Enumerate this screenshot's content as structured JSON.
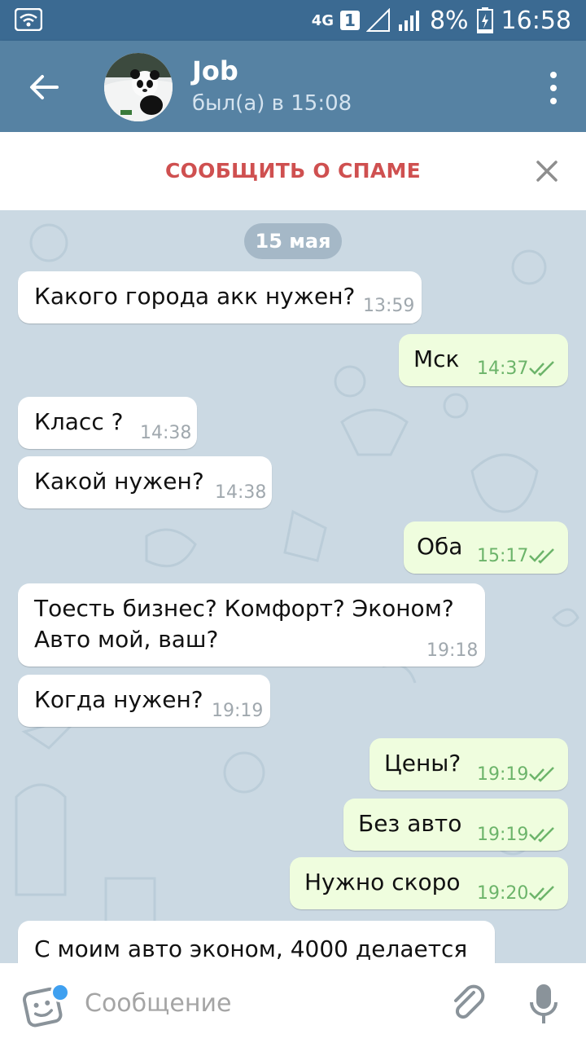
{
  "status": {
    "network": "4G",
    "sim": "1",
    "battery": "8%",
    "time": "16:58"
  },
  "header": {
    "title": "Job",
    "subtitle": "был(а) в 15:08"
  },
  "spam": {
    "label": "СООБЩИТЬ О СПАМЕ"
  },
  "chat": {
    "date": "15 мая",
    "messages": [
      {
        "dir": "in",
        "text": "Какого города акк нужен?",
        "time": "13:59"
      },
      {
        "dir": "out",
        "text": "Мск",
        "time": "14:37"
      },
      {
        "dir": "in",
        "text": "Класс ?",
        "time": "14:38"
      },
      {
        "dir": "in",
        "text": "Какой нужен?",
        "time": "14:38"
      },
      {
        "dir": "out",
        "text": "Оба",
        "time": "15:17"
      },
      {
        "dir": "in",
        "text": "Тоесть бизнес? Комфорт? Эконом?",
        "text2": "Авто мой, ваш?",
        "time": "19:18"
      },
      {
        "dir": "in",
        "text": "Когда нужен?",
        "time": "19:19"
      },
      {
        "dir": "out",
        "text": "Цены?",
        "time": "19:19"
      },
      {
        "dir": "out",
        "text": "Без авто",
        "time": "19:19"
      },
      {
        "dir": "out",
        "text": "Нужно скоро",
        "time": "19:20"
      },
      {
        "dir": "in",
        "text": "С моим авто эконом, 4000 делается",
        "time": ""
      }
    ]
  },
  "composer": {
    "placeholder": "Сообщение"
  },
  "colors": {
    "header": "#5682a3",
    "statusbar": "#3b6a92",
    "spam": "#cf5050",
    "outgoing": "#effdde",
    "check": "#6cb46a"
  }
}
